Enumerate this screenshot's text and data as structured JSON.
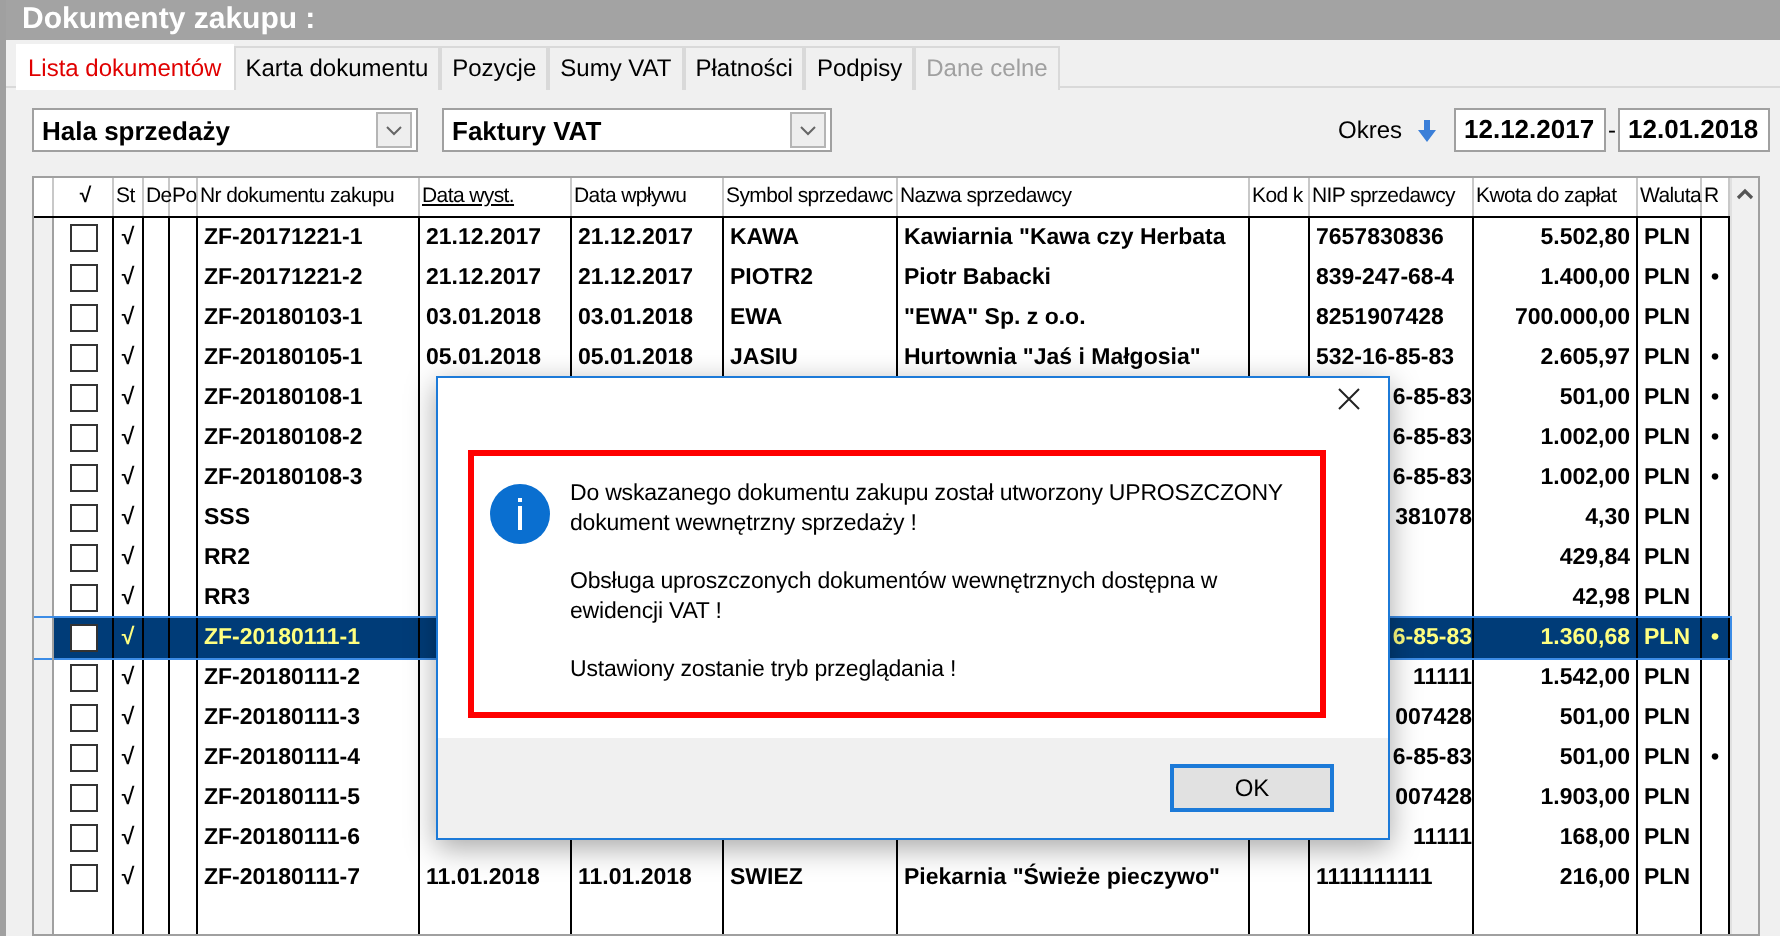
{
  "window": {
    "title": "Dokumenty zakupu :"
  },
  "tabs": [
    {
      "label": "Lista dokumentów",
      "selected": true,
      "disabled": false
    },
    {
      "label": "Karta dokumentu",
      "selected": false,
      "disabled": false
    },
    {
      "label": "Pozycje",
      "selected": false,
      "disabled": false
    },
    {
      "label": "Sumy VAT",
      "selected": false,
      "disabled": false
    },
    {
      "label": "Płatności",
      "selected": false,
      "disabled": false
    },
    {
      "label": "Podpisy",
      "selected": false,
      "disabled": false
    },
    {
      "label": "Dane celne",
      "selected": false,
      "disabled": true
    }
  ],
  "filters": {
    "location": {
      "value": "Hala sprzedaży"
    },
    "doc_type": {
      "value": "Faktury VAT"
    },
    "period_label": "Okres",
    "date_from": "12.12.2017",
    "date_separator": "-",
    "date_to": "12.01.2018"
  },
  "table": {
    "columns": [
      {
        "label": "√",
        "sorted": false
      },
      {
        "label": "St",
        "sorted": false
      },
      {
        "label": "De",
        "sorted": false
      },
      {
        "label": "Po",
        "sorted": false
      },
      {
        "label": "Nr dokumentu zakupu",
        "sorted": false
      },
      {
        "label": "Data wyst.",
        "sorted": true
      },
      {
        "label": "Data wpływu",
        "sorted": false
      },
      {
        "label": "Symbol sprzedawc",
        "sorted": false
      },
      {
        "label": "Nazwa sprzedawcy",
        "sorted": false
      },
      {
        "label": "Kod k",
        "sorted": false
      },
      {
        "label": "NIP sprzedawcy",
        "sorted": false
      },
      {
        "label": "Kwota do zapłat",
        "sorted": false
      },
      {
        "label": "Waluta",
        "sorted": false
      },
      {
        "label": "R",
        "sorted": false
      }
    ],
    "rows": [
      {
        "checked": false,
        "selected": false,
        "status": "√",
        "number": "ZF-20171221-1",
        "issued": "21.12.2017",
        "received": "21.12.2017",
        "symbol": "KAWA",
        "name": "Kawiarnia \"Kawa czy Herbata",
        "nip": "7657830836",
        "amount": "5.502,80",
        "currency": "PLN"
      },
      {
        "checked": false,
        "selected": false,
        "status": "√",
        "number": "ZF-20171221-2",
        "issued": "21.12.2017",
        "received": "21.12.2017",
        "symbol": "PIOTR2",
        "name": "Piotr Babacki",
        "nip": "839-247-68-4",
        "amount": "1.400,00",
        "currency": "PLN",
        "mark": "•"
      },
      {
        "checked": false,
        "selected": false,
        "status": "√",
        "number": "ZF-20180103-1",
        "issued": "03.01.2018",
        "received": "03.01.2018",
        "symbol": "EWA",
        "name": "\"EWA\" Sp. z o.o.",
        "nip": "8251907428",
        "amount": "700.000,00",
        "currency": "PLN"
      },
      {
        "checked": false,
        "selected": false,
        "status": "√",
        "number": "ZF-20180105-1",
        "issued": "05.01.2018",
        "received": "05.01.2018",
        "symbol": "JASIU",
        "name": "Hurtownia \"Jaś i Małgosia\"",
        "nip": "532-16-85-83",
        "amount": "2.605,97",
        "currency": "PLN",
        "mark": "•"
      },
      {
        "checked": false,
        "selected": false,
        "status": "√",
        "number": "ZF-20180108-1",
        "nip_end": "6-85-83",
        "amount": "501,00",
        "currency": "PLN",
        "mark": "•"
      },
      {
        "checked": false,
        "selected": false,
        "status": "√",
        "number": "ZF-20180108-2",
        "nip_end": "6-85-83",
        "amount": "1.002,00",
        "currency": "PLN",
        "mark": "•"
      },
      {
        "checked": false,
        "selected": false,
        "status": "√",
        "number": "ZF-20180108-3",
        "nip_end": "6-85-83",
        "amount": "1.002,00",
        "currency": "PLN",
        "mark": "•"
      },
      {
        "checked": false,
        "selected": false,
        "status": "√",
        "number": "SSS",
        "nip_end": "381078",
        "amount": "4,30",
        "currency": "PLN"
      },
      {
        "checked": false,
        "selected": false,
        "status": "√",
        "number": "RR2",
        "amount": "429,84",
        "currency": "PLN"
      },
      {
        "checked": false,
        "selected": false,
        "status": "√",
        "number": "RR3",
        "amount": "42,98",
        "currency": "PLN"
      },
      {
        "checked": false,
        "selected": true,
        "status": "√",
        "number": "ZF-20180111-1",
        "nip_end": "6-85-83",
        "amount": "1.360,68",
        "currency": "PLN",
        "mark": "•"
      },
      {
        "checked": false,
        "selected": false,
        "status": "√",
        "number": "ZF-20180111-2",
        "nip_end": "11111",
        "amount": "1.542,00",
        "currency": "PLN"
      },
      {
        "checked": false,
        "selected": false,
        "status": "√",
        "number": "ZF-20180111-3",
        "nip_end": "007428",
        "amount": "501,00",
        "currency": "PLN"
      },
      {
        "checked": false,
        "selected": false,
        "status": "√",
        "number": "ZF-20180111-4",
        "nip_end": "6-85-83",
        "amount": "501,00",
        "currency": "PLN",
        "mark": "•"
      },
      {
        "checked": false,
        "selected": false,
        "status": "√",
        "number": "ZF-20180111-5",
        "nip_end": "007428",
        "amount": "1.903,00",
        "currency": "PLN"
      },
      {
        "checked": false,
        "selected": false,
        "status": "√",
        "number": "ZF-20180111-6",
        "nip_end": "11111",
        "amount": "168,00",
        "currency": "PLN"
      },
      {
        "checked": false,
        "selected": false,
        "status": "√",
        "number": "ZF-20180111-7",
        "issued": "11.01.2018",
        "received": "11.01.2018",
        "symbol": "SWIEZ",
        "name": "Piekarnia \"Świeże pieczywo\"",
        "nip": "1111111111",
        "amount": "216,00",
        "currency": "PLN"
      }
    ]
  },
  "dialog": {
    "message": [
      "Do wskazanego dokumentu zakupu został utworzony UPROSZCZONY dokument wewnętrzny sprzedaży !",
      "Obsługa uproszczonych dokumentów wewnętrznych dostępna w ewidencji VAT !",
      "Ustawiony zostanie tryb przeglądania !"
    ],
    "button": "OK"
  }
}
